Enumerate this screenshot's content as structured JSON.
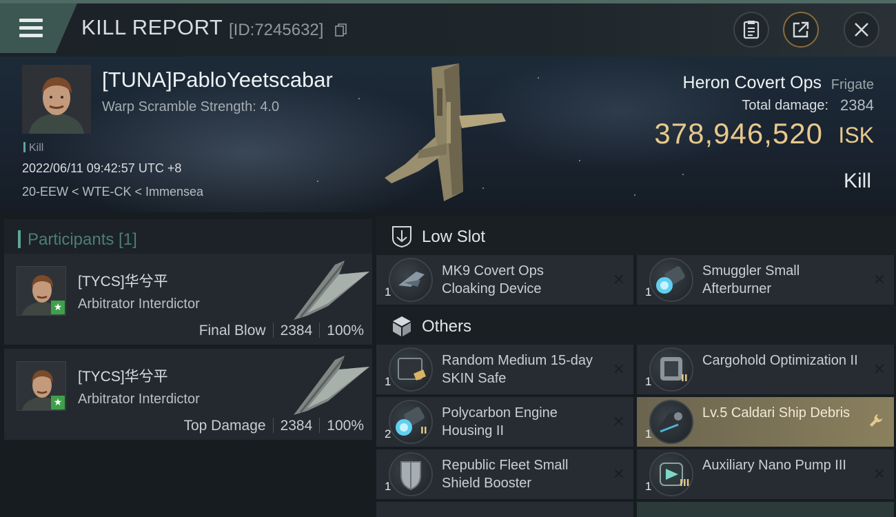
{
  "header": {
    "title": "KILL REPORT",
    "report_id": "[ID:7245632]",
    "menu_icon": "hamburger-menu-icon",
    "buttons": [
      "clipboard-icon",
      "share-icon",
      "close-icon"
    ]
  },
  "victim": {
    "name": "[TUNA]PabloYeetscabar",
    "warp_scramble": "Warp Scramble Strength: 4.0",
    "tag": "Kill",
    "timestamp": "2022/06/11 09:42:57 UTC +8",
    "location": "20-EEW < WTE-CK < Immensea",
    "ship_name": "Heron Covert Ops",
    "ship_class": "Frigate",
    "total_damage_label": "Total damage:",
    "total_damage": "2384",
    "isk_value": "378,946,520",
    "isk_unit": "ISK",
    "result": "Kill"
  },
  "participants": {
    "header": "Participants [1]",
    "list": [
      {
        "name": "[TYCS]华兮平",
        "ship": "Arbitrator Interdictor",
        "role": "Final Blow",
        "damage": "2384",
        "percent": "100%"
      },
      {
        "name": "[TYCS]华兮平",
        "ship": "Arbitrator Interdictor",
        "role": "Top Damage",
        "damage": "2384",
        "percent": "100%"
      }
    ]
  },
  "sections": {
    "low_slot": {
      "label": "Low Slot",
      "icon": "low-slot-icon",
      "items": [
        {
          "qty": "1",
          "name": "MK9 Covert Ops Cloaking Device"
        },
        {
          "qty": "1",
          "name": "Smuggler Small Afterburner"
        }
      ]
    },
    "others": {
      "label": "Others",
      "icon": "cube-icon",
      "items": [
        {
          "qty": "1",
          "name": "Random Medium 15-day SKIN Safe"
        },
        {
          "qty": "1",
          "name": "Cargohold Optimization II",
          "tier": "II"
        },
        {
          "qty": "2",
          "name": "Polycarbon Engine Housing II",
          "tier": "II"
        },
        {
          "qty": "1",
          "name": "Lv.5 Caldari Ship Debris"
        },
        {
          "qty": "1",
          "name": "Republic Fleet Small Shield Booster"
        },
        {
          "qty": "1",
          "name": "Auxiliary Nano Pump III",
          "tier": "III"
        }
      ]
    }
  },
  "colors": {
    "accent": "#5fa69a",
    "isk": "#e8c98c",
    "highlight": "#8a805e"
  }
}
